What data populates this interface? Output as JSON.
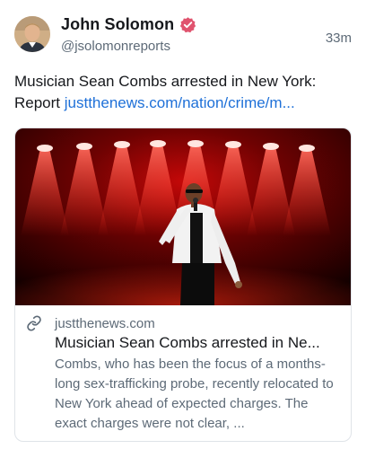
{
  "post": {
    "author_name": "John Solomon",
    "author_handle": "@jsolomonreports",
    "timestamp": "33m",
    "text": "Musician Sean Combs arrested in New York: Report ",
    "link_text": "justthenews.com/nation/crime/m...",
    "icons": {
      "verified": "verified-badge-icon",
      "link": "link-icon"
    }
  },
  "link_card": {
    "domain": "justthenews.com",
    "title": "Musician Sean Combs arrested in Ne...",
    "description": "Combs, who has been the focus of a months-long sex-trafficking probe, recently relocated to New York ahead of expected charges. The exact charges were not clear, ..."
  },
  "colors": {
    "link": "#1e70d8",
    "verified_badge": "#e0536e",
    "secondary_text": "#5d6a77",
    "stage_red": "#e01010"
  }
}
